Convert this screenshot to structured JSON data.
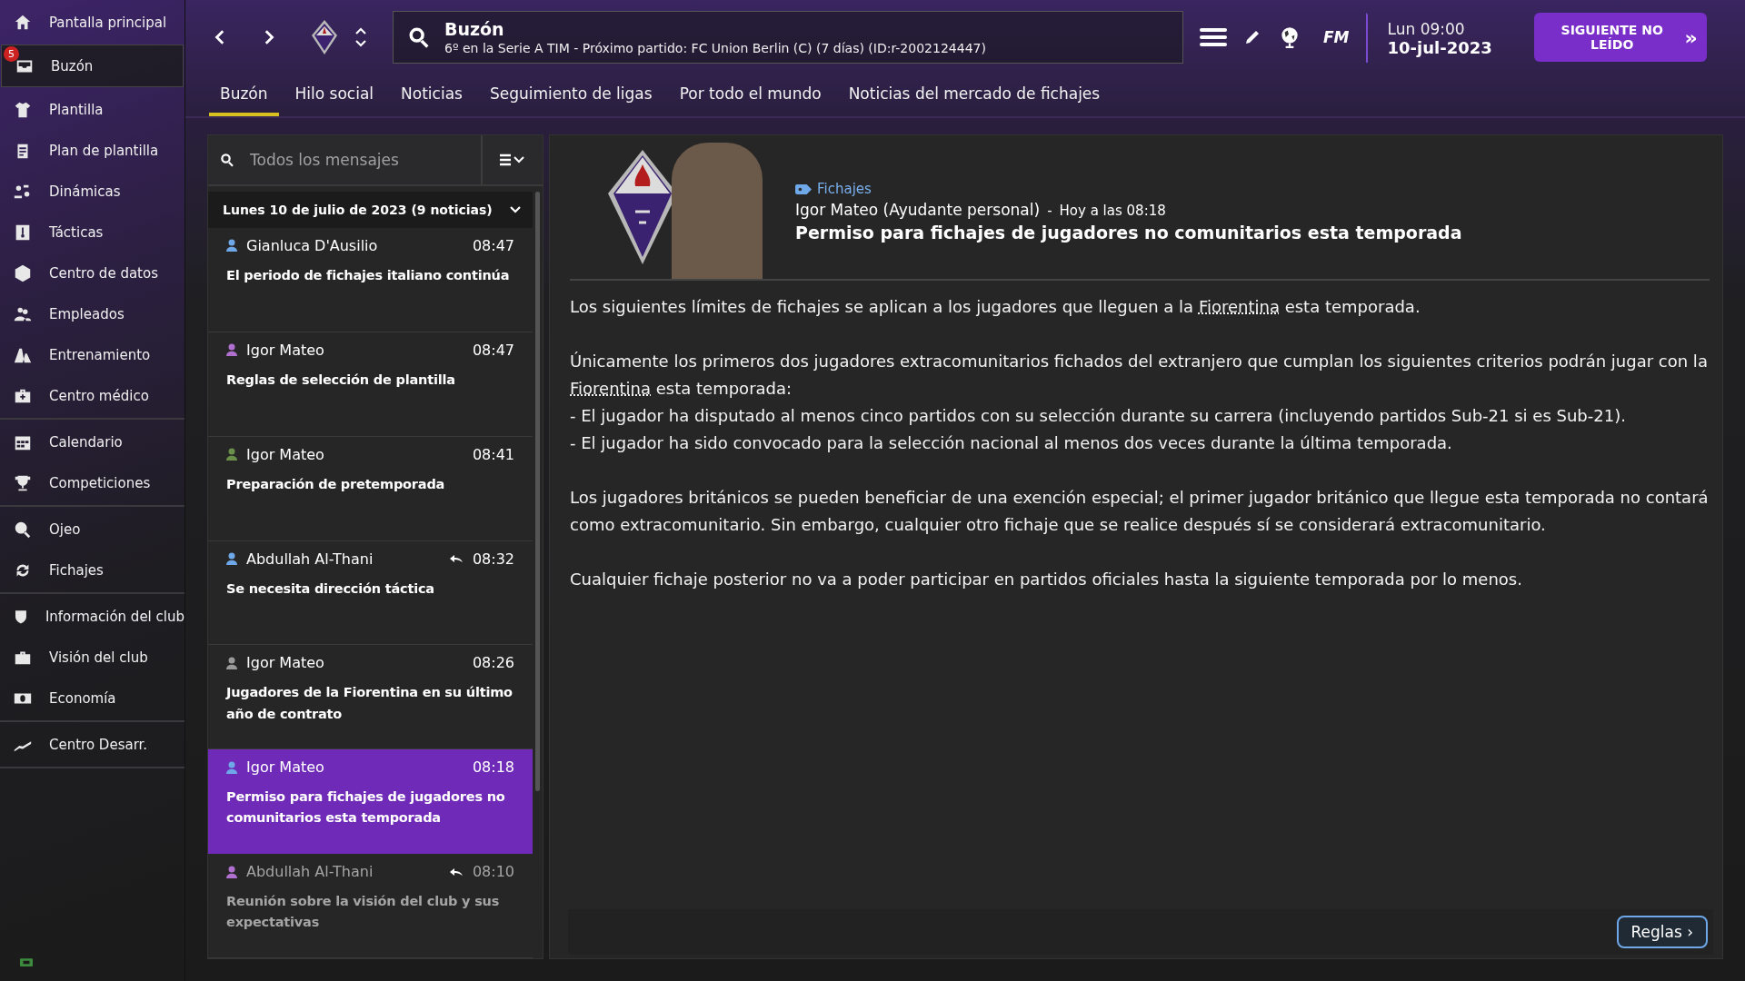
{
  "sidebar": {
    "groups": [
      [
        {
          "label": "Pantalla principal",
          "selected": false
        },
        {
          "label": "Buzón",
          "selected": true,
          "badge": "5"
        },
        {
          "label": "Plantilla",
          "selected": false
        },
        {
          "label": "Plan de plantilla",
          "selected": false
        },
        {
          "label": "Dinámicas",
          "selected": false
        },
        {
          "label": "Tácticas",
          "selected": false
        },
        {
          "label": "Centro de datos",
          "selected": false
        },
        {
          "label": "Empleados",
          "selected": false
        },
        {
          "label": "Entrenamiento",
          "selected": false
        },
        {
          "label": "Centro médico",
          "selected": false
        }
      ],
      [
        {
          "label": "Calendario",
          "selected": false
        },
        {
          "label": "Competiciones",
          "selected": false
        }
      ],
      [
        {
          "label": "Ojeo",
          "selected": false
        },
        {
          "label": "Fichajes",
          "selected": false
        }
      ],
      [
        {
          "label": "Información del club",
          "selected": false
        },
        {
          "label": "Visión del club",
          "selected": false
        },
        {
          "label": "Economía",
          "selected": false
        }
      ],
      [
        {
          "label": "Centro Desarr.",
          "selected": false
        }
      ]
    ]
  },
  "header": {
    "title": "Buzón",
    "subtitle": "6º en la Serie A TIM - Próximo partido: FC Union Berlin (C) (7 días) (ID:r-2002124447)",
    "fm_label": "FM",
    "day_time": "Lun 09:00",
    "date": "10-jul-2023",
    "next_button": "SIGUIENTE NO LEÍDO",
    "next_arrows": "»"
  },
  "tabs": [
    {
      "label": "Buzón",
      "selected": true
    },
    {
      "label": "Hilo social",
      "selected": false
    },
    {
      "label": "Noticias",
      "selected": false
    },
    {
      "label": "Seguimiento de ligas",
      "selected": false
    },
    {
      "label": "Por todo el mundo",
      "selected": false
    },
    {
      "label": "Noticias del mercado de fichajes",
      "selected": false
    }
  ],
  "message_list": {
    "search": {
      "placeholder": "Todos los mensajes"
    },
    "group_header": "Lunes 10 de julio de 2023 (9 noticias)",
    "expanded": true,
    "messages": [
      {
        "sender": "Gianluca D'Ausilio",
        "time": "08:47",
        "subject": "El periodo de fichajes italiano continúa",
        "color": "#6ea8e8",
        "replied": false,
        "selected": false,
        "dimmed": false
      },
      {
        "sender": "Igor Mateo",
        "time": "08:47",
        "subject": "Reglas de selección de plantilla",
        "color": "#b070d0",
        "replied": false,
        "selected": false,
        "dimmed": false
      },
      {
        "sender": "Igor Mateo",
        "time": "08:41",
        "subject": "Preparación de pretemporada",
        "color": "#6a8f4a",
        "replied": false,
        "selected": false,
        "dimmed": false
      },
      {
        "sender": "Abdullah Al-Thani",
        "time": "08:32",
        "subject": "Se necesita dirección táctica",
        "color": "#6ea8e8",
        "replied": true,
        "selected": false,
        "dimmed": false
      },
      {
        "sender": "Igor Mateo",
        "time": "08:26",
        "subject": "Jugadores de la Fiorentina en su último año de contrato",
        "color": "#9a9a9a",
        "replied": false,
        "selected": false,
        "dimmed": false
      },
      {
        "sender": "Igor Mateo",
        "time": "08:18",
        "subject": "Permiso para fichajes de jugadores no comunitarios esta temporada",
        "color": "#6ea8e8",
        "replied": false,
        "selected": true,
        "dimmed": false
      },
      {
        "sender": "Abdullah Al-Thani",
        "time": "08:10",
        "subject": "Reunión sobre la visión del club y sus expectativas",
        "color": "#b070d0",
        "replied": true,
        "selected": false,
        "dimmed": true
      }
    ]
  },
  "message": {
    "category": "Fichajes",
    "sender": "Igor Mateo (Ayudante personal)",
    "separator": "-",
    "when": "Hoy a las 08:18",
    "subject": "Permiso para fichajes de jugadores no comunitarios esta temporada",
    "blocks": [
      [
        {
          "text": "Los siguientes límites de fichajes se aplican a los jugadores que lleguen a la ",
          "link": "Fiorentina",
          "after": " esta temporada."
        }
      ],
      [
        {
          "text": "Únicamente los primeros dos jugadores extracomunitarios fichados del extranjero que cumplan los siguientes criterios podrán jugar con la ",
          "link": "Fiorentina",
          "after": " esta temporada:"
        },
        {
          "text": "- El jugador ha disputado al menos cinco partidos con su selección durante su carrera (incluyendo partidos Sub-21 si es Sub-21)."
        },
        {
          "text": "- El jugador ha sido convocado para la selección nacional al menos dos veces durante la última temporada."
        }
      ],
      [
        {
          "text": "Los jugadores británicos se pueden beneficiar de una exención especial; el primer jugador británico que llegue esta temporada no contará como extracomunitario. Sin embargo, cualquier otro fichaje que se realice después sí se considerará extracomunitario."
        }
      ],
      [
        {
          "text": "Cualquier fichaje posterior no va a poder participar en partidos oficiales hasta la siguiente temporada por lo menos."
        }
      ]
    ],
    "rules_button": "Reglas ›"
  }
}
